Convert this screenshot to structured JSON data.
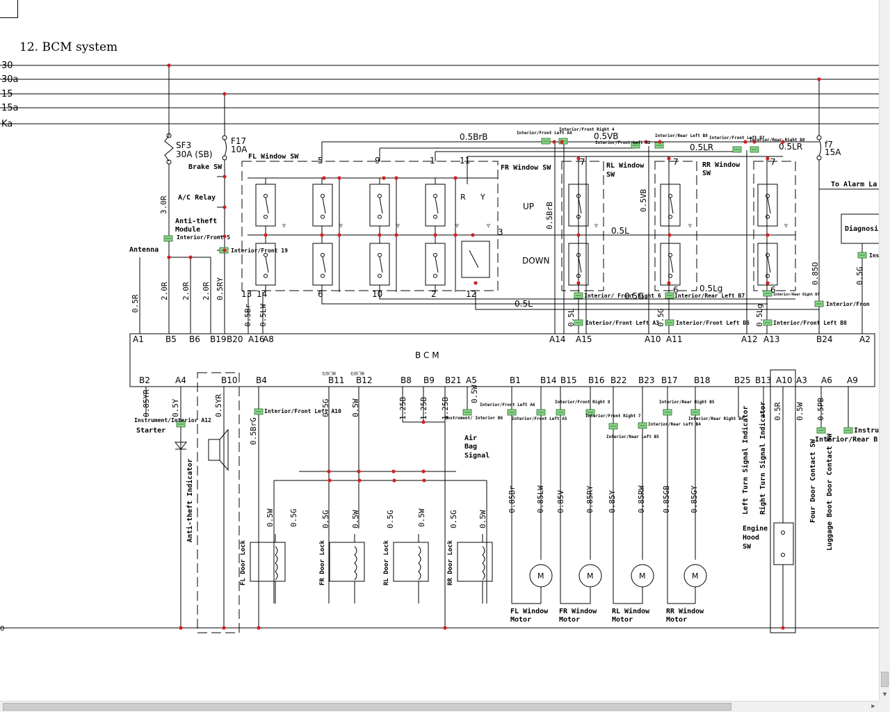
{
  "page": {
    "title": "12. BCM system"
  },
  "rails": [
    "30",
    "30a",
    "15",
    "15a",
    "Ka"
  ],
  "ground_rail": "0",
  "fuses": [
    {
      "name": "SF3",
      "rating": "30A (SB)"
    },
    {
      "name": "F17",
      "rating": "10A"
    },
    {
      "name": "f7",
      "rating": "15A"
    }
  ],
  "labels": {
    "brake_sw": "Brake SW",
    "ac_relay": "A/C Relay",
    "anti_theft_module": [
      "Anti-theft",
      "Module"
    ],
    "antenna": "Antenna",
    "fl_window_sw": "FL Window SW",
    "fr_window_sw": "FR Window SW",
    "rl_window_sw": [
      "RL Window",
      "SW"
    ],
    "rr_window_sw": [
      "RR Window",
      "SW"
    ],
    "up": "UP",
    "down": "DOWN",
    "to_alarm": "To Alarm La",
    "diagnosis": "Diagnosi",
    "bcm": "B  C  M",
    "starter": "Starter",
    "instrument_interior": "Instrument/Interior A12",
    "anti_theft_indicator": "Anti-theft Indicator",
    "air_bag": [
      "Air",
      "Bag",
      "Signal"
    ],
    "left_turn": "Left Turn Signal Indicator",
    "right_turn": "Right Turn Signal Indicator",
    "engine_hood": [
      "Engine",
      "Hood",
      "SW"
    ],
    "four_door": "Four Door Contact SW",
    "luggage": "Luggage Boot Door Contact SW",
    "interior_rear_b": "Interior/Rear B",
    "instru": "Instru",
    "ins": "Ins",
    "r": "R",
    "y": "Y"
  },
  "door_locks": [
    "FL Door Lock",
    "FR Door Lock",
    "RL Door Lock",
    "RR Door Lock"
  ],
  "motors": [
    [
      "FL Window",
      "Motor"
    ],
    [
      "FR Window",
      "Motor"
    ],
    [
      "RL Window",
      "Motor"
    ],
    [
      "RR Window",
      "Motor"
    ]
  ],
  "bcm_top_pins": [
    "A1",
    "B5",
    "B6",
    "B19",
    "B20",
    "A16",
    "A8",
    "A14",
    "A15",
    "A10",
    "A11",
    "A12",
    "A13",
    "B24",
    "A2"
  ],
  "bcm_bottom_pins": [
    "B2",
    "A4",
    "B10",
    "B4",
    "B11",
    "B12",
    "B8",
    "B9",
    "B21",
    "A5",
    "B1",
    "B14",
    "B15",
    "B16",
    "B22",
    "B23",
    "B17",
    "B18",
    "B25",
    "B13",
    "A10",
    "A3",
    "A6",
    "A9"
  ],
  "switch_pins": [
    "5",
    "9",
    "1",
    "11",
    "13",
    "14",
    "6",
    "10",
    "2",
    "12",
    "3",
    "7",
    "7",
    "7",
    "6",
    "6"
  ],
  "wires_top": [
    "0.5R",
    "2.0R",
    "2.0R",
    "2.0R",
    "0.5RY",
    "0.5Br",
    "0.5LW",
    "3.0R",
    "0.5BrB",
    "0.5VB",
    "0.5LR",
    "0.5L",
    "0.5G",
    "0.5L",
    "0.5Lg",
    "0.5BrB",
    "0.5VB",
    "0.5L",
    "0.5G",
    "0.5Lg",
    "0.85O",
    "0.5G"
  ],
  "wires_bottom": [
    "0.85YR",
    "0.5Y",
    "0.5YR",
    "0.5BrG",
    "0.5G",
    "0.5W",
    "1.25B",
    "1.25B",
    "1.25B",
    "0.5W",
    "0.5W",
    "0.5G",
    "0.5G",
    "0.5W",
    "0.5G",
    "0.5W",
    "0.5G",
    "0.5W",
    "0.85Br",
    "0.85LW",
    "0.85V",
    "0.85RY",
    "0.85Y",
    "0.85RW",
    "0.85GB",
    "0.85GY",
    "0.5R",
    "0.5W",
    "0.5PB"
  ],
  "connectors": [
    "Interior/Front 5",
    "Interior/Front 19",
    "Interior/Front Left A4",
    "Interior/Front Right 4",
    "Interior/Front Left A2",
    "Interior/Rear Left B8",
    "Interior/Front Left B7",
    "Interior/Rear Right B8",
    "Interior/ Front Right 6",
    "Interior/Rear Left B7",
    "Interior/Rear Right B7",
    "Interior/Front Left A3",
    "Interior/Front Left B6",
    "Interior/Front Left B8",
    "Interior/Fron",
    "Interior/Front Left A10",
    "Instrument/ Interior B6",
    "Interior/Front Left A6",
    "Interior/Front Left A5",
    "Interior/Front Right 8",
    "Interior/Front Right 7",
    "Interior/Rear Left B5",
    "Interior/Rear Left B4",
    "Interior/Rear Right B5",
    "Interior/Rear Right B4",
    "Interior/Rear B"
  ],
  "small_notes": [
    "左前门锁",
    "右前门锁"
  ]
}
